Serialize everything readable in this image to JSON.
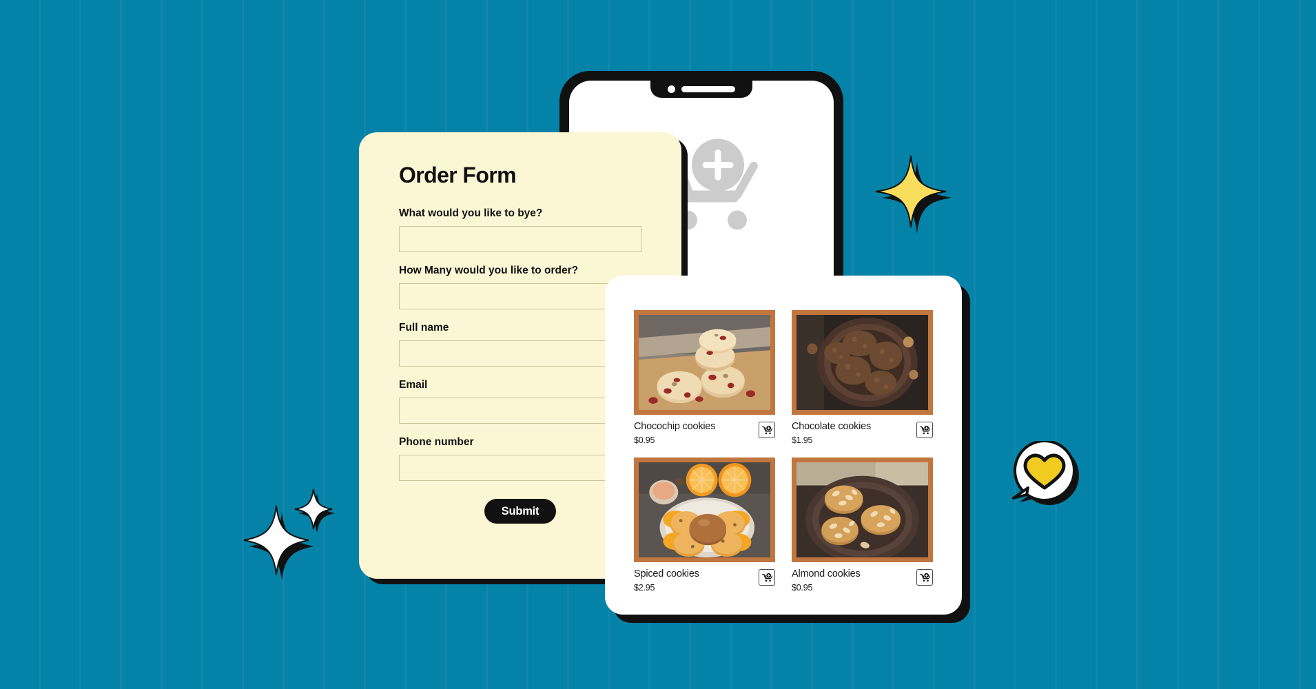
{
  "background": {
    "color": "#0582a8",
    "stripe_pattern": "vertical-stripes"
  },
  "phone": {
    "name": "smartphone-mockup",
    "screen_bg": "#ffffff",
    "frame_color": "#111111",
    "notch": {
      "camera": "camera-dot",
      "speaker": "speaker-grille"
    },
    "content_icon": "add-to-cart-icon",
    "icon_color": "#cccccc"
  },
  "order_form": {
    "title": "Order Form",
    "card_color": "#fbf7d5",
    "shadow_color": "#111111",
    "fields": [
      {
        "label": "What would you like to bye?",
        "value": "",
        "placeholder": ""
      },
      {
        "label": "How Many would you like to order?",
        "value": "",
        "placeholder": ""
      },
      {
        "label": "Full name",
        "value": "",
        "placeholder": ""
      },
      {
        "label": "Email",
        "value": "",
        "placeholder": ""
      },
      {
        "label": "Phone number",
        "value": "",
        "placeholder": ""
      }
    ],
    "submit_label": "Submit"
  },
  "tablet": {
    "name": "tablet-mockup",
    "screen_bg": "#ffffff",
    "image_frame_color": "#c2763f",
    "products": [
      {
        "name": "Chocochip cookies",
        "price": "$0.95",
        "image": "chocochip-cookies-photo",
        "cart_icon": "add-to-cart-icon"
      },
      {
        "name": "Chocolate cookies",
        "price": "$1.95",
        "image": "chocolate-cookies-photo",
        "cart_icon": "add-to-cart-icon"
      },
      {
        "name": "Spiced cookies",
        "price": "$2.95",
        "image": "spiced-cookies-photo",
        "cart_icon": "add-to-cart-icon"
      },
      {
        "name": "Almond cookies",
        "price": "$0.95",
        "image": "almond-cookies-photo",
        "cart_icon": "add-to-cart-icon"
      }
    ]
  },
  "decorations": [
    {
      "name": "sparkle-yellow",
      "icon": "four-point-star-icon",
      "color": "#f9dd5c"
    },
    {
      "name": "sparkle-white-large",
      "icon": "four-point-star-icon",
      "color": "#ffffff"
    },
    {
      "name": "sparkle-white-small",
      "icon": "four-point-star-icon",
      "color": "#ffffff"
    },
    {
      "name": "heart-bubble",
      "icon": "heart-in-speech-bubble-icon",
      "color": "#f2cb20"
    }
  ]
}
